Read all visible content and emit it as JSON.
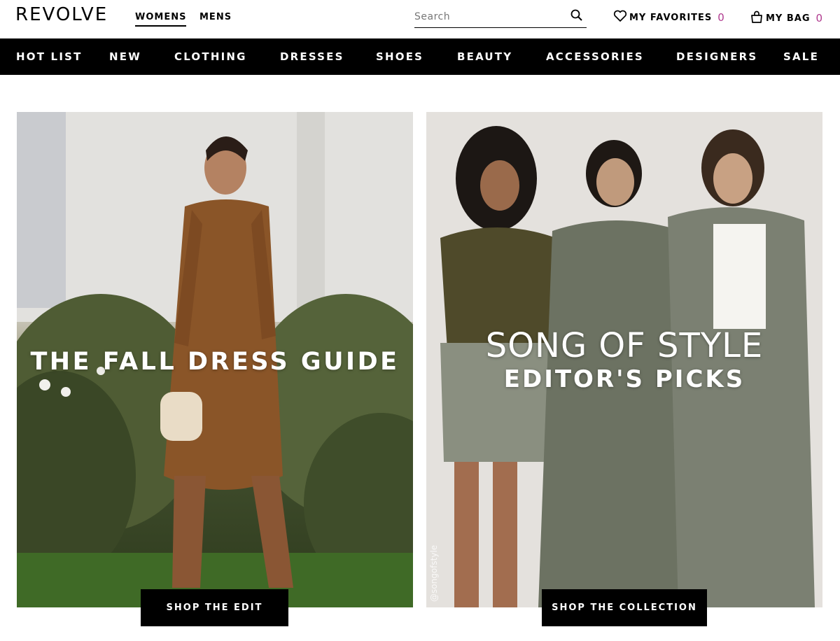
{
  "header": {
    "logo": "REVOLVE",
    "gender_tabs": [
      "WOMENS",
      "MENS"
    ],
    "search": {
      "placeholder": "Search"
    },
    "favorites": {
      "label": "MY FAVORITES",
      "count": "0"
    },
    "bag": {
      "label": "MY BAG",
      "count": "0"
    }
  },
  "nav": {
    "items": [
      "HOT LIST",
      "NEW",
      "CLOTHING",
      "DRESSES",
      "SHOES",
      "BEAUTY",
      "ACCESSORIES",
      "DESIGNERS",
      "SALE"
    ]
  },
  "hero": {
    "left": {
      "title": "THE FALL DRESS GUIDE",
      "cta": "SHOP THE EDIT"
    },
    "right": {
      "title": "SONG OF STYLE",
      "subtitle": "EDITOR'S PICKS",
      "watermark": "@songofstyle",
      "cta": "SHOP THE COLLECTION"
    }
  },
  "colors": {
    "accent_count": "#b03b8f",
    "nav_bg": "#000000"
  }
}
